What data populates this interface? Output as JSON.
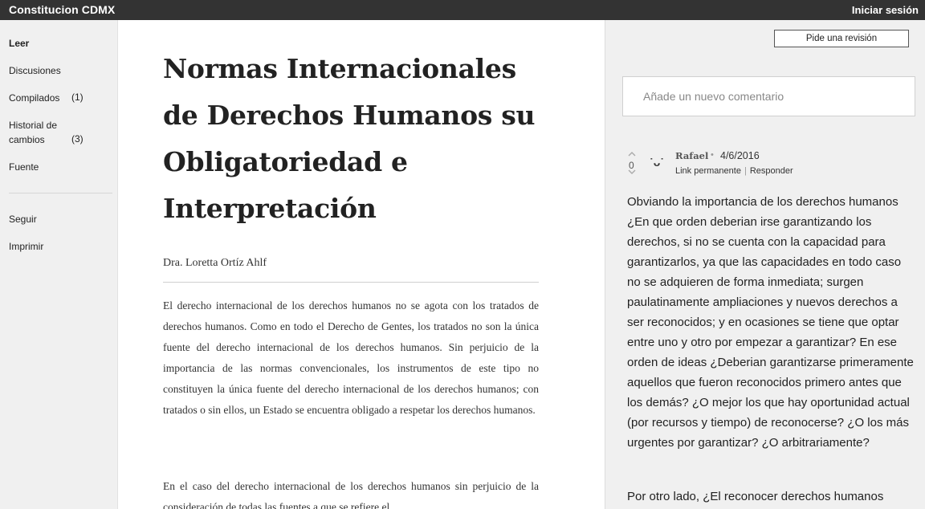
{
  "topbar": {
    "brand": "Constitucion CDMX",
    "login": "Iniciar sesión"
  },
  "sidebar": {
    "read": "Leer",
    "discussions": "Discusiones",
    "compiled": "Compilados",
    "compiled_count": "(1)",
    "history_line1": "Historial de",
    "history_line2": "cambios",
    "history_count": "(3)",
    "source": "Fuente",
    "follow": "Seguir",
    "print": "Imprimir"
  },
  "document": {
    "title": "Normas Internacionales de Derechos Humanos su Obligatoriedad e Interpretación",
    "author": "Dra. Loretta Ortíz Ahlf",
    "paragraph1": "El derecho internacional de los derechos humanos no se agota con los tratados de derechos humanos. Como en todo el Derecho de Gentes, los tratados no son la única fuente del derecho internacional de los derechos humanos. Sin perjuicio de la importancia de las normas convencionales, los instrumentos de este tipo no constituyen la única fuente del derecho internacional de los derechos humanos; con tratados o sin ellos, un Estado se encuentra obligado a respetar los derechos humanos.",
    "paragraph2": "En el caso del derecho internacional de los derechos humanos sin perjuicio de la consideración de todas las fuentes a que se refiere el"
  },
  "comments": {
    "review_button": "Pide una revisión",
    "input_placeholder": "Añade un nuevo comentario",
    "items": [
      {
        "votes": "0",
        "avatar_glyph": "˙ᴗ˙",
        "author": "Rafael",
        "separator": "•",
        "date": "4/6/2016",
        "permalink": "Link permanente",
        "link_sep": "|",
        "reply": "Responder",
        "body": "Obviando la importancia de los derechos humanos ¿En que orden deberian irse garantizando los derechos, si no se cuenta con la capacidad para garantizarlos, ya que las capacidades en todo caso no se adquieren de forma inmediata; surgen paulatinamente ampliaciones y nuevos derechos a ser reconocidos; y en ocasiones se tiene que optar entre uno y otro por empezar a garantizar? En ese orden de ideas ¿Deberian garantizarse primeramente aquellos que fueron reconocidos primero antes que los demás? ¿O mejor los que hay oportunidad actual (por recursos y tiempo) de reconocerse? ¿O los más urgentes por garantizar? ¿O arbitrariamente?",
        "body2": "Por otro lado, ¿El reconocer derechos humanos"
      }
    ]
  },
  "icons": {
    "vote_up": "chevron-up-icon",
    "vote_down": "chevron-down-icon"
  },
  "colors": {
    "topbar": "#333333",
    "page_bg": "#f0f0f0",
    "doc_bg": "#ffffff"
  }
}
